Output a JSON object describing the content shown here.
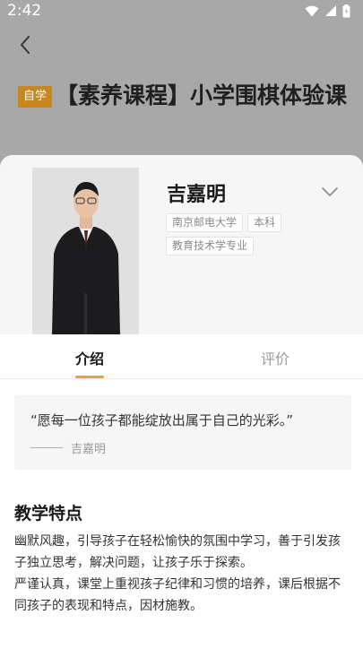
{
  "status_bar": {
    "time": "2:42",
    "icons": [
      "wifi-icon",
      "signal-icon",
      "battery-icon"
    ]
  },
  "header": {
    "back_icon": "back-arrow-icon",
    "tag": "自学",
    "title": "【素养课程】小学围棋体验课"
  },
  "teacher": {
    "name": "吉嘉明",
    "expand_icon": "chevron-down-icon",
    "tags": [
      "南京邮电大学",
      "本科",
      "教育技术学专业"
    ]
  },
  "tabs": [
    {
      "label": "介绍",
      "active": true
    },
    {
      "label": "评价",
      "active": false
    }
  ],
  "quote": {
    "text": "“愿每一位孩子都能绽放出属于自己的光彩。”",
    "author": "吉嘉明"
  },
  "teaching": {
    "title": "教学特点",
    "paragraphs": [
      "幽默风趣，引导孩子在轻松愉快的氛围中学习，善于引发孩子独立思考，解决问题，让孩子乐于探索。",
      "严谨认真，课堂上重视孩子纪律和习惯的培养，课后根据不同孩子的表现和特点，因材施教。"
    ]
  },
  "colors": {
    "accent": "#e8a23c",
    "tag_bg": "#c7861f",
    "backdrop": "#a8a8a8"
  }
}
